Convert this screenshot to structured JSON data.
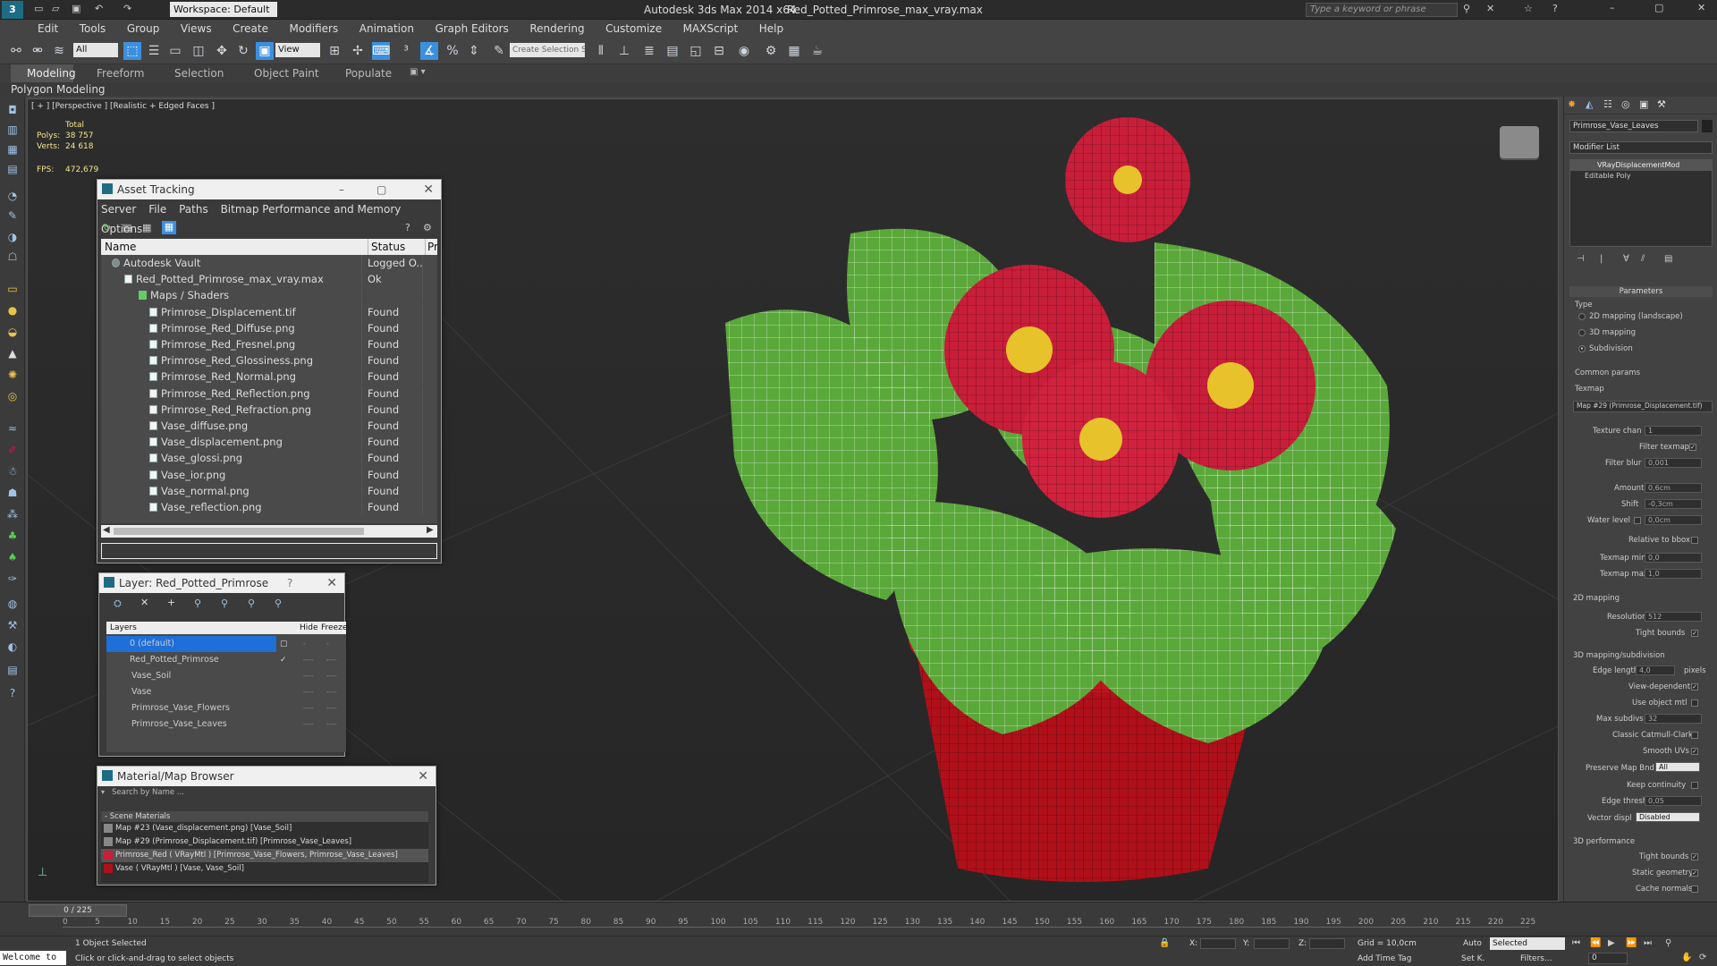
{
  "titlebar": {
    "workspace": "Workspace: Default",
    "app_title": "Autodesk 3ds Max  2014 x64",
    "file_title": "Red_Potted_Primrose_max_vray.max",
    "search_placeholder": "Type a keyword or phrase"
  },
  "menu": [
    "Edit",
    "Tools",
    "Group",
    "Views",
    "Create",
    "Modifiers",
    "Animation",
    "Graph Editors",
    "Rendering",
    "Customize",
    "MAXScript",
    "Help"
  ],
  "toolbar": {
    "filter_all": "All",
    "view_dropdown": "View",
    "selection_set": "Create Selection S"
  },
  "ribbon": {
    "tabs": [
      "Modeling",
      "Freeform",
      "Selection",
      "Object Paint",
      "Populate"
    ],
    "sub": "Polygon Modeling"
  },
  "viewport": {
    "label": "[ + ] [Perspective ] [Realistic + Edged Faces ]",
    "stats": {
      "total": "Total",
      "polys_label": "Polys:",
      "polys": "38 757",
      "verts_label": "Verts:",
      "verts": "24 618",
      "fps_label": "FPS:",
      "fps": "472,679"
    }
  },
  "asset_tracking": {
    "title": "Asset Tracking",
    "menu": [
      "Server",
      "File",
      "Paths",
      "Bitmap Performance and Memory",
      "Options"
    ],
    "columns": {
      "name": "Name",
      "status": "Status",
      "pro": "Pro"
    },
    "rows": [
      {
        "name": "Autodesk Vault",
        "status": "Logged O..."
      },
      {
        "name": "Red_Potted_Primrose_max_vray.max",
        "status": "Ok"
      },
      {
        "name": "Maps / Shaders",
        "status": ""
      },
      {
        "name": "Primrose_Displacement.tif",
        "status": "Found"
      },
      {
        "name": "Primrose_Red_Diffuse.png",
        "status": "Found"
      },
      {
        "name": "Primrose_Red_Fresnel.png",
        "status": "Found"
      },
      {
        "name": "Primrose_Red_Glossiness.png",
        "status": "Found"
      },
      {
        "name": "Primrose_Red_Normal.png",
        "status": "Found"
      },
      {
        "name": "Primrose_Red_Reflection.png",
        "status": "Found"
      },
      {
        "name": "Primrose_Red_Refraction.png",
        "status": "Found"
      },
      {
        "name": "Vase_diffuse.png",
        "status": "Found"
      },
      {
        "name": "Vase_displacement.png",
        "status": "Found"
      },
      {
        "name": "Vase_glossi.png",
        "status": "Found"
      },
      {
        "name": "Vase_ior.png",
        "status": "Found"
      },
      {
        "name": "Vase_normal.png",
        "status": "Found"
      },
      {
        "name": "Vase_reflection.png",
        "status": "Found"
      }
    ]
  },
  "layer_window": {
    "title": "Layer: Red_Potted_Primrose",
    "help": "?",
    "columns": {
      "layers": "Layers",
      "hide": "Hide",
      "freeze": "Freeze"
    },
    "rows": [
      {
        "name": "0 (default)"
      },
      {
        "name": "Red_Potted_Primrose"
      },
      {
        "name": "Vase_Soil"
      },
      {
        "name": "Vase"
      },
      {
        "name": "Primrose_Vase_Flowers"
      },
      {
        "name": "Primrose_Vase_Leaves"
      }
    ]
  },
  "material_browser": {
    "title": "Material/Map Browser",
    "search_placeholder": "Search by Name ...",
    "section": "- Scene Materials",
    "items": [
      {
        "label": "Map #23 (Vase_displacement.png) [Vase_Soil]"
      },
      {
        "label": "Map #29 (Primrose_Displacement.tif) [Primrose_Vase_Leaves]"
      },
      {
        "label": "Primrose_Red ( VRayMtl ) [Primrose_Vase_Flowers, Primrose_Vase_Leaves]"
      },
      {
        "label": "Vase ( VRayMtl ) [Vase, Vase_Soil]"
      }
    ]
  },
  "right_panel": {
    "object_name": "Primrose_Vase_Leaves",
    "modifier_list": "Modifier List",
    "stack": [
      "VRayDisplacementMod",
      "Editable Poly"
    ],
    "params_title": "Parameters",
    "type_label": "Type",
    "types": [
      "2D mapping (landscape)",
      "3D mapping",
      "Subdivision"
    ],
    "common_params": "Common params",
    "texmap_label": "Texmap",
    "texmap": "Map #29 (Primrose_Displacement.tif)",
    "fields": [
      {
        "label": "Texture chan",
        "value": "1"
      },
      {
        "label": "Filter texmap",
        "value": ""
      },
      {
        "label": "Filter blur",
        "value": "0,001"
      },
      {
        "label": "Amount",
        "value": "0,6cm"
      },
      {
        "label": "Shift",
        "value": "-0,3cm"
      },
      {
        "label": "Water level",
        "value": "0,0cm"
      },
      {
        "label": "Relative to bbox",
        "value": ""
      },
      {
        "label": "Texmap min",
        "value": "0,0"
      },
      {
        "label": "Texmap max",
        "value": "1,0"
      }
    ],
    "mapping2d": "2D mapping",
    "resolution": {
      "label": "Resolution",
      "value": "512"
    },
    "tight_bounds": "Tight bounds",
    "mapping3d": "3D mapping/subdivision",
    "edge_length": {
      "label": "Edge length",
      "value": "4,0",
      "unit": "pixels"
    },
    "view_dependent": "View-dependent",
    "use_object_mtl": "Use object mtl",
    "max_subdivs": {
      "label": "Max subdivs",
      "value": "32"
    },
    "classic": "Classic Catmull-Clark",
    "smooth_uvs": "Smooth UVs",
    "preserve": {
      "label": "Preserve Map Bnd",
      "value": "All"
    },
    "keep_continuity": "Keep continuity",
    "edge_thresh": {
      "label": "Edge thresh",
      "value": "0,05"
    },
    "vector_disp": {
      "label": "Vector displ",
      "value": "Disabled"
    },
    "perf": "3D performance",
    "perf_items": [
      "Tight bounds",
      "Static geometry",
      "Cache normals"
    ]
  },
  "timeline": {
    "frame": "0 / 225",
    "ticks": [
      "0",
      "5",
      "10",
      "15",
      "20",
      "25",
      "30",
      "35",
      "40",
      "45",
      "50",
      "55",
      "60",
      "65",
      "70",
      "75",
      "80",
      "85",
      "90",
      "95",
      "100",
      "105",
      "110",
      "115",
      "120",
      "125",
      "130",
      "135",
      "140",
      "145",
      "150",
      "155",
      "160",
      "165",
      "170",
      "175",
      "180",
      "185",
      "190",
      "195",
      "200",
      "205",
      "210",
      "215",
      "220",
      "225"
    ]
  },
  "status": {
    "welcome": "Welcome to",
    "selected": "1 Object Selected",
    "hint": "Click or click-and-drag to select objects",
    "x": "X:",
    "y": "Y:",
    "z": "Z:",
    "grid": "Grid = 10,0cm",
    "add_time_tag": "Add Time Tag",
    "auto": "Auto",
    "set_k": "Set K.",
    "selected_dd": "Selected",
    "filters": "Filters...",
    "frame_field": "0"
  },
  "colors": {
    "accent": "#3c8fde",
    "selection": "#1e6fd8",
    "flower": "#c81e3a",
    "leaf": "#5aa83a",
    "vase": "#b0101a"
  }
}
